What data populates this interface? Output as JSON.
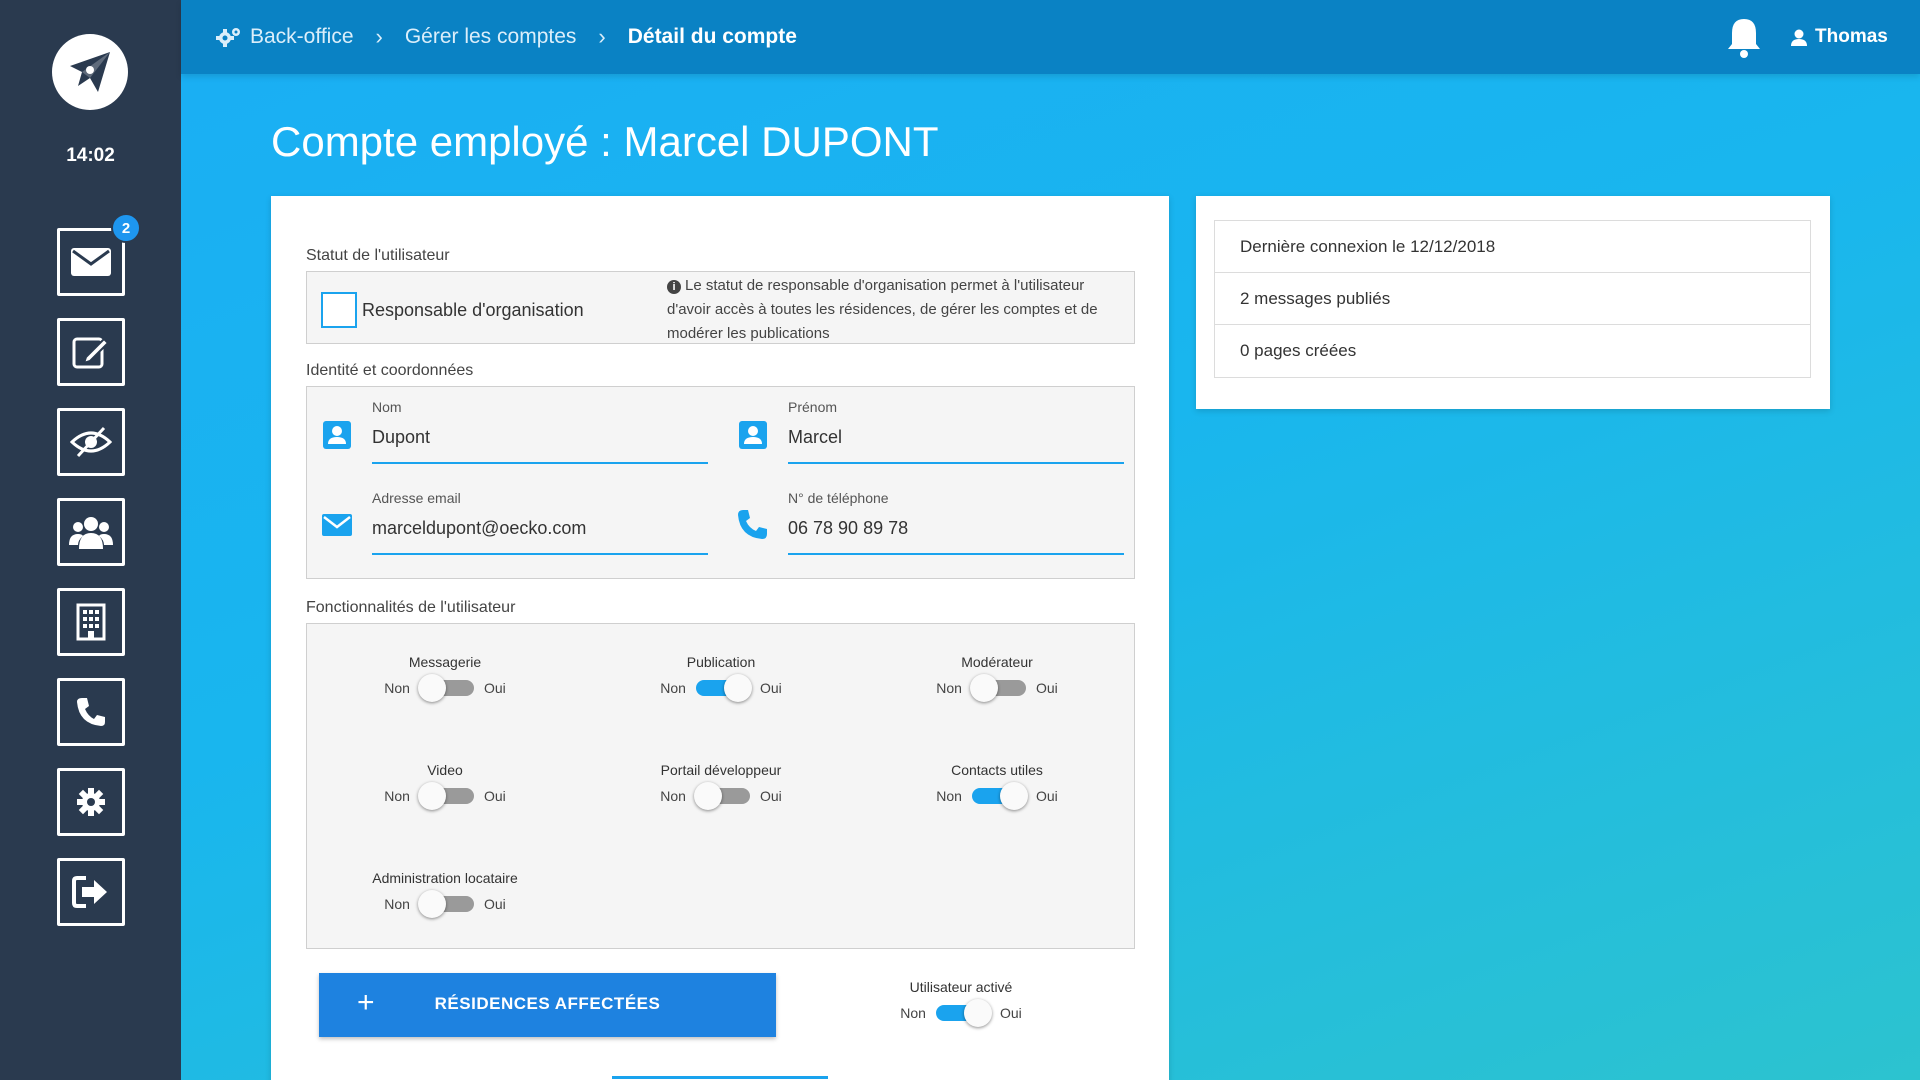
{
  "sidebar": {
    "clock": "14:02",
    "mail_badge": "2",
    "items": [
      {
        "icon": "mail-icon"
      },
      {
        "icon": "edit-icon"
      },
      {
        "icon": "eye-slash-icon"
      },
      {
        "icon": "users-icon"
      },
      {
        "icon": "building-icon"
      },
      {
        "icon": "phone-icon"
      },
      {
        "icon": "gear-icon"
      },
      {
        "icon": "logout-icon"
      }
    ]
  },
  "header": {
    "breadcrumb": [
      "Back-office",
      "Gérer les comptes",
      "Détail du compte"
    ],
    "user": "Thomas"
  },
  "page_title": "Compte employé : Marcel DUPONT",
  "status": {
    "section_label": "Statut de l'utilisateur",
    "checkbox_label": "Responsable d'organisation",
    "checked": false,
    "info": "Le statut de responsable d'organisation permet à l'utilisateur d'avoir accès à toutes les résidences, de gérer les comptes et de modérer les publications"
  },
  "identity": {
    "section_label": "Identité et coordonnées",
    "last_name": {
      "label": "Nom",
      "value": "Dupont"
    },
    "first_name": {
      "label": "Prénom",
      "value": "Marcel"
    },
    "email": {
      "label": "Adresse email",
      "value": "marceldupont@oecko.com"
    },
    "phone": {
      "label": "N° de téléphone",
      "value": "06 78 90 89 78"
    }
  },
  "features": {
    "section_label": "Fonctionnalités de l'utilisateur",
    "off_label": "Non",
    "on_label": "Oui",
    "items": [
      {
        "label": "Messagerie",
        "on": false
      },
      {
        "label": "Publication",
        "on": true
      },
      {
        "label": "Modérateur",
        "on": false
      },
      {
        "label": "Video",
        "on": false
      },
      {
        "label": "Portail développeur",
        "on": false
      },
      {
        "label": "Contacts utiles",
        "on": true
      },
      {
        "label": "Administration locataire",
        "on": false
      }
    ]
  },
  "actions": {
    "residences_button": "RÉSIDENCES AFFECTÉES",
    "plus": "+",
    "active_label": "Utilisateur activé",
    "active_on": true
  },
  "stats": [
    "Dernière connexion le 12/12/2018",
    "2 messages publiés",
    "0 pages créées"
  ],
  "colors": {
    "sidebar": "#2a3a4f",
    "topbar": "#0a82c4",
    "accent": "#1aa3ee",
    "button": "#1e82e0"
  }
}
